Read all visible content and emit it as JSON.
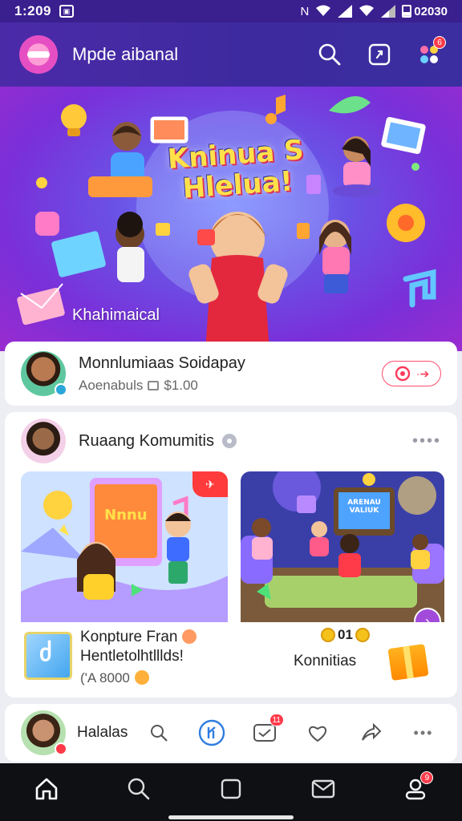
{
  "status_bar": {
    "time": "1:209",
    "battery_text": "02030"
  },
  "app_bar": {
    "title": "Mpde aibanal",
    "notification_count": "6"
  },
  "hero": {
    "title_line1": "Kninua S",
    "title_line2": "Hlelua!",
    "subtitle": "Khahimaical"
  },
  "user_card": {
    "name": "Monnlumiaas Soidapay",
    "meta_label": "Aoenabuls",
    "meta_value": "$1.00"
  },
  "community": {
    "title": "Ruaang Komumitis",
    "more": "••••",
    "tile_left": {
      "screen_text": "Nnnu",
      "title_line1": "Konpture Fran",
      "title_line2": "Hentletolhtlllds!",
      "price": "('A 8000"
    },
    "tile_right": {
      "screen_text": "ARENAU VALIUK",
      "coins_text": "01",
      "label": "Konnitias"
    }
  },
  "post_bar": {
    "name": "Halalas",
    "message_badge": "11"
  },
  "nav": {
    "profile_badge": "9"
  },
  "colors": {
    "primary": "#4b2aa8",
    "accent": "#ff3b4a",
    "nav_bg": "#0e1014"
  },
  "icons": [
    "search-icon",
    "share-icon",
    "apps-icon",
    "home-icon",
    "chat-icon",
    "profile-icon"
  ]
}
